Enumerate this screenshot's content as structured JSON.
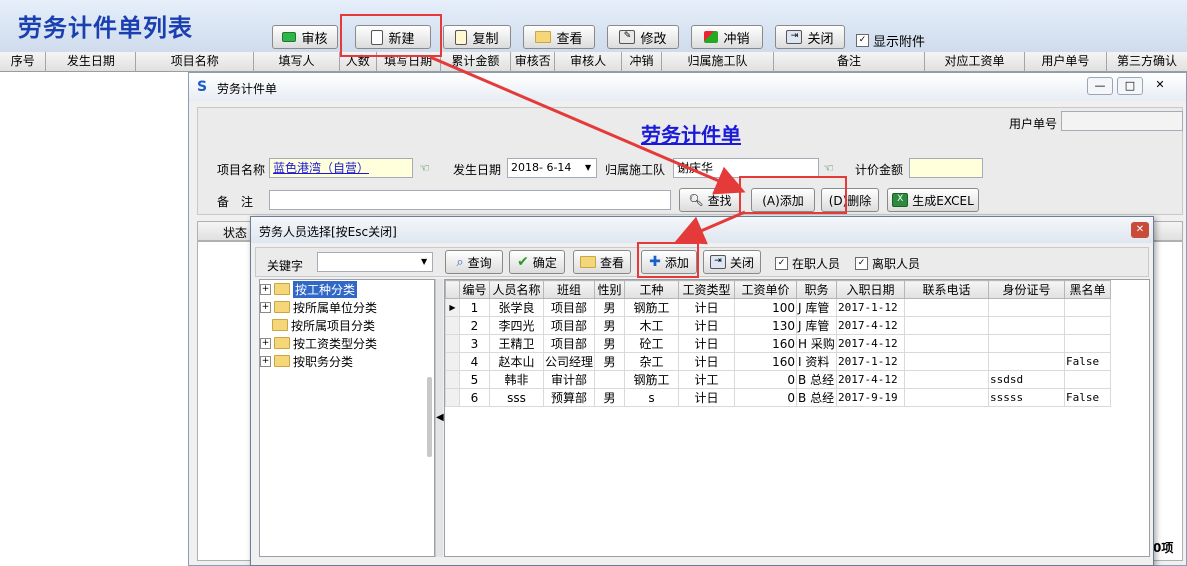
{
  "main": {
    "title": "劳务计件单列表",
    "toolbar": {
      "audit": "审核",
      "new": "新建",
      "copy": "复制",
      "view": "查看",
      "modify": "修改",
      "reverse": "冲销",
      "close": "关闭",
      "show_attachment": "显示附件"
    },
    "columns": [
      "序号",
      "发生日期",
      "项目名称",
      "填写人",
      "人数",
      "填写日期",
      "累计金额",
      "审核否",
      "审核人",
      "冲销",
      "归属施工队",
      "备注",
      "对应工资单",
      "用户单号",
      "第三方确认"
    ]
  },
  "piece_dialog": {
    "window_title": "劳务计件单",
    "heading": "劳务计件单",
    "user_no_label": "用户单号",
    "project_label": "项目名称",
    "project_value": "蓝色港湾（自营）",
    "date_label": "发生日期",
    "date_value": "2018- 6-14",
    "team_label": "归属施工队",
    "team_value": "谢庆华",
    "amount_label": "计价金额",
    "remark_label": "备　注",
    "find_button": "查找",
    "add_button": "(A)添加",
    "delete_button": "(D)删除",
    "excel_button": "生成EXCEL",
    "grid_status_col": "状态",
    "footer_text": "0项"
  },
  "staff_dialog": {
    "title": "劳务人员选择[按Esc关闭]",
    "keyword_label": "关键字",
    "buttons": {
      "query": "查询",
      "confirm": "确定",
      "view": "查看",
      "add": "添加",
      "close": "关闭"
    },
    "on_job_label": "在职人员",
    "left_job_label": "离职人员",
    "tree": [
      "按工种分类",
      "按所属单位分类",
      "按所属项目分类",
      "按工资类型分类",
      "按职务分类"
    ],
    "columns": [
      "编号",
      "人员名称",
      "班组",
      "性别",
      "工种",
      "工资类型",
      "工资单价",
      "职务",
      "入职日期",
      "联系电话",
      "身份证号",
      "黑名单"
    ],
    "rows": [
      [
        "1",
        "张学良",
        "项目部",
        "男",
        "钢筋工",
        "计日",
        "100",
        "J",
        "库管",
        "2017-1-12",
        "",
        "",
        ""
      ],
      [
        "2",
        "李四光",
        "项目部",
        "男",
        "木工",
        "计日",
        "130",
        "J",
        "库管",
        "2017-4-12",
        "",
        "",
        ""
      ],
      [
        "3",
        "王精卫",
        "项目部",
        "男",
        "砼工",
        "计日",
        "160",
        "H",
        "采购",
        "2017-4-12",
        "",
        "",
        ""
      ],
      [
        "4",
        "赵本山",
        "公司经理",
        "男",
        "杂工",
        "计日",
        "160",
        "I",
        "资料",
        "2017-1-12",
        "",
        "",
        "False"
      ],
      [
        "5",
        "韩非",
        "审计部",
        "",
        "钢筋工",
        "计工",
        "0",
        "B",
        "总经",
        "2017-4-12",
        "",
        "ssdsd",
        ""
      ],
      [
        "6",
        "sss",
        "预算部",
        "男",
        "s",
        "计日",
        "0",
        "B",
        "总经",
        "2017-9-19",
        "",
        "sssss",
        "False"
      ]
    ]
  }
}
